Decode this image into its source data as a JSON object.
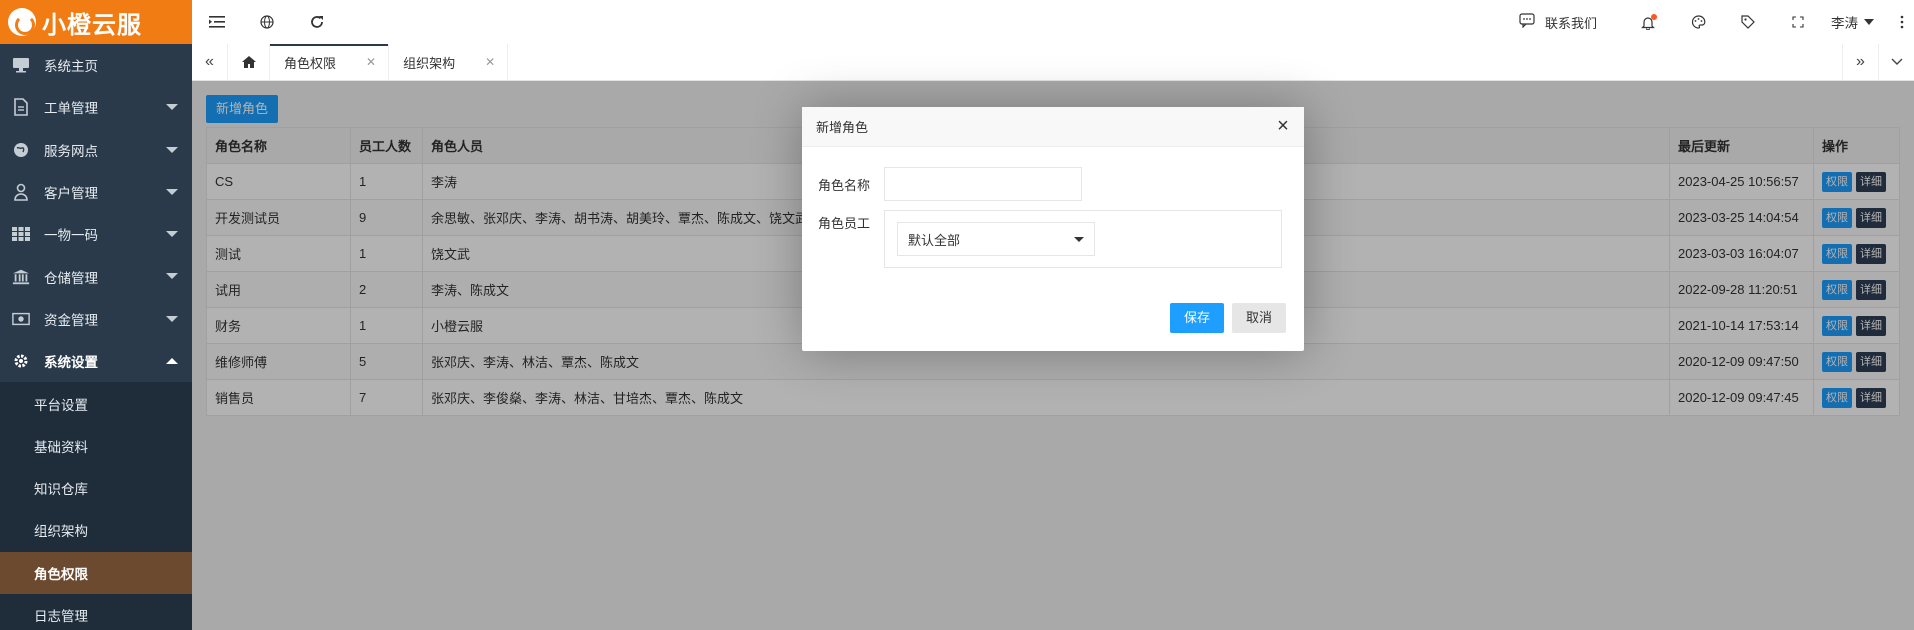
{
  "logo": {
    "text": "小橙云服"
  },
  "sidebar": {
    "items": [
      {
        "label": "系统主页",
        "icon": "monitor-icon",
        "has_caret": false
      },
      {
        "label": "工单管理",
        "icon": "document-icon",
        "has_caret": true
      },
      {
        "label": "服务网点",
        "icon": "globe-icon",
        "has_caret": true
      },
      {
        "label": "客户管理",
        "icon": "user-icon",
        "has_caret": true
      },
      {
        "label": "一物一码",
        "icon": "grid-icon",
        "has_caret": true
      },
      {
        "label": "仓储管理",
        "icon": "bank-icon",
        "has_caret": true
      },
      {
        "label": "资金管理",
        "icon": "money-icon",
        "has_caret": true
      },
      {
        "label": "系统设置",
        "icon": "gear-icon",
        "has_caret": true
      }
    ],
    "submenu": [
      {
        "label": "平台设置"
      },
      {
        "label": "基础资料"
      },
      {
        "label": "知识仓库"
      },
      {
        "label": "组织架构"
      },
      {
        "label": "角色权限",
        "active": true
      },
      {
        "label": "日志管理"
      }
    ]
  },
  "topbar": {
    "contact_label": "联系我们",
    "user_name": "李涛"
  },
  "tabs": {
    "items": [
      {
        "label": "角色权限",
        "active": true
      },
      {
        "label": "组织架构",
        "active": false
      }
    ]
  },
  "main": {
    "add_button": "新增角色",
    "columns": [
      "角色名称",
      "员工人数",
      "角色人员",
      "最后更新",
      "操作"
    ],
    "rows": [
      {
        "name": "CS",
        "count": "1",
        "members": "李涛",
        "updated": "2023-04-25 10:56:57"
      },
      {
        "name": "开发测试员",
        "count": "9",
        "members": "余思敏、张邓庆、李涛、胡书涛、胡美玲、覃杰、陈成文、饶文武",
        "updated": "2023-03-25 14:04:54"
      },
      {
        "name": "测试",
        "count": "1",
        "members": "饶文武",
        "updated": "2023-03-03 16:04:07"
      },
      {
        "name": "试用",
        "count": "2",
        "members": "李涛、陈成文",
        "updated": "2022-09-28 11:20:51"
      },
      {
        "name": "财务",
        "count": "1",
        "members": "小橙云服",
        "updated": "2021-10-14 17:53:14"
      },
      {
        "name": "维修师傅",
        "count": "5",
        "members": "张邓庆、李涛、林洁、覃杰、陈成文",
        "updated": "2020-12-09 09:47:50"
      },
      {
        "name": "销售员",
        "count": "7",
        "members": "张邓庆、李俊燊、李涛、林洁、甘培杰、覃杰、陈成文",
        "updated": "2020-12-09 09:47:45"
      }
    ],
    "perm_label": "权限",
    "detail_label": "详细"
  },
  "modal": {
    "title": "新增角色",
    "name_label": "角色名称",
    "name_value": "",
    "staff_label": "角色员工",
    "staff_select": "默认全部",
    "save_label": "保存",
    "cancel_label": "取消"
  },
  "colors": {
    "brand": "#f07c13",
    "sidebar": "#2b3a4a",
    "primary": "#1e9fff",
    "active_sub": "#6b4a2f"
  }
}
